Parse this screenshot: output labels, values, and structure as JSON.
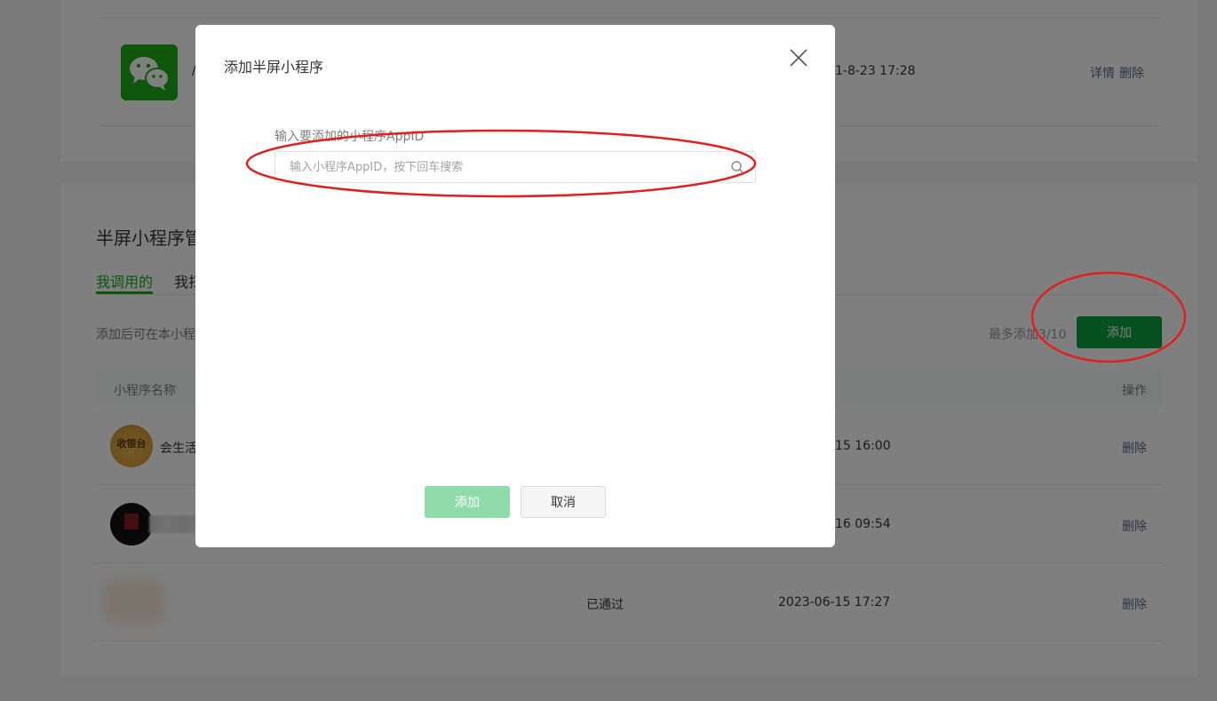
{
  "top_card": {
    "time": "1-8-23 17:28",
    "detail_link": "详情",
    "delete_link": "删除",
    "name_fragment": "/"
  },
  "section": {
    "title": "半屏小程序管",
    "tabs": [
      {
        "label": "我调用的"
      },
      {
        "label": "我扫"
      }
    ],
    "hint": "添加后可在本小程",
    "limit_text": "最多添加3/10",
    "add_button": "添加"
  },
  "table": {
    "headers": {
      "name": "小程序名称",
      "action": "操作"
    },
    "rows": [
      {
        "name": "会生活",
        "avatar_text": "收银台",
        "status": "",
        "time": "15 16:00",
        "action": "删除"
      },
      {
        "name": "",
        "avatar_text": "",
        "status": "",
        "time": "16 09:54",
        "action": "删除"
      },
      {
        "name": "",
        "avatar_text": "",
        "status": "已通过",
        "time": "2023-06-15 17:27",
        "action": "删除"
      }
    ]
  },
  "dialog": {
    "title": "添加半屏小程序",
    "field_label": "输入要添加的小程序AppID",
    "search_placeholder": "输入小程序AppID，按下回车搜索",
    "search_value": "",
    "confirm_button": "添加",
    "cancel_button": "取消"
  },
  "colors": {
    "brand_green": "#07c160",
    "add_button_bg": "#0c9e3f",
    "disabled_green": "#8fdcaa",
    "link_blue": "#576b95",
    "annotation_red": "#e02020"
  },
  "icons": {
    "close": "close-icon",
    "search": "search-icon",
    "wechat": "wechat-logo"
  }
}
